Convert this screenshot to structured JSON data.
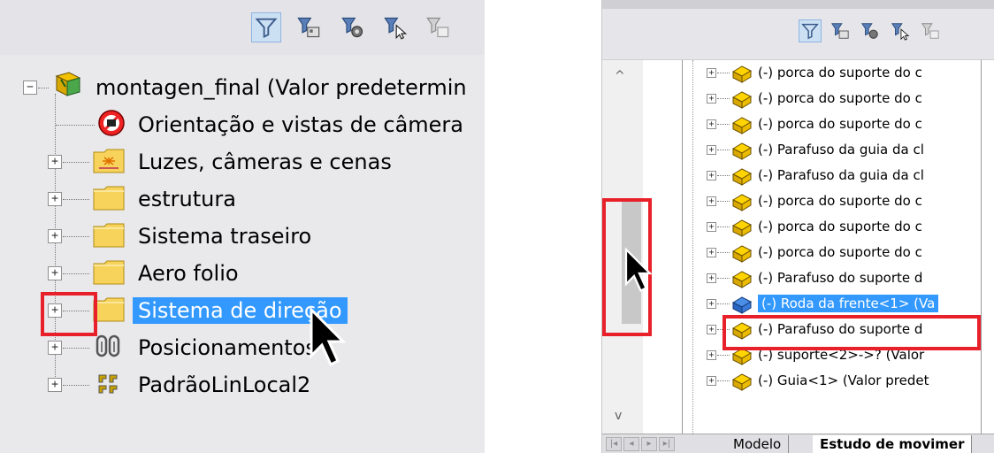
{
  "left_panel": {
    "tree": [
      {
        "label": "montagen_final  (Valor predetermin",
        "icon": "assembly-icon",
        "expander": "−"
      },
      {
        "label": "Orientação e vistas de câmera",
        "icon": "camera-orientation-icon",
        "expander": ""
      },
      {
        "label": "Luzes, câmeras e cenas",
        "icon": "lights-folder-icon",
        "expander": "+"
      },
      {
        "label": "estrutura",
        "icon": "folder-icon",
        "expander": "+"
      },
      {
        "label": "Sistema traseiro",
        "icon": "folder-icon",
        "expander": "+"
      },
      {
        "label": "Aero folio",
        "icon": "folder-icon",
        "expander": "+"
      },
      {
        "label": "Sistema de direção",
        "icon": "folder-icon",
        "expander": "+",
        "selected": true
      },
      {
        "label": "Posicionamentos",
        "icon": "mates-icon",
        "expander": "+"
      },
      {
        "label": "PadrãoLinLocal2",
        "icon": "linear-pattern-icon",
        "expander": "+"
      }
    ]
  },
  "right_panel": {
    "tree": [
      {
        "label": "(-) porca do suporte do c",
        "icon": "part-icon"
      },
      {
        "label": "(-) porca do suporte do c",
        "icon": "part-icon"
      },
      {
        "label": "(-) porca do suporte do c",
        "icon": "part-icon"
      },
      {
        "label": "(-) Parafuso da guia da cl",
        "icon": "part-icon"
      },
      {
        "label": "(-) Parafuso da guia da cl",
        "icon": "part-icon"
      },
      {
        "label": "(-) porca do suporte do c",
        "icon": "part-icon"
      },
      {
        "label": "(-) porca do suporte do c",
        "icon": "part-icon"
      },
      {
        "label": "(-) porca do suporte do c",
        "icon": "part-icon"
      },
      {
        "label": "(-) Parafuso do suporte d",
        "icon": "part-icon"
      },
      {
        "label": "(-) Roda da frente<1> (Va",
        "icon": "part-icon",
        "selected": true
      },
      {
        "label": "(-) Parafuso do suporte d",
        "icon": "part-icon"
      },
      {
        "label": "(-) suporte<2>->? (Valor",
        "icon": "part-icon"
      },
      {
        "label": "(-) Guia<1> (Valor predet",
        "icon": "part-icon"
      }
    ],
    "tabs": {
      "model": "Modelo",
      "motion_study": "Estudo de movimer"
    },
    "scroll_up": "^",
    "scroll_down": "v"
  },
  "toolbar_icons": [
    "filter-icon",
    "filter-hide-components-icon",
    "filter-features-icon",
    "filter-selection-icon",
    "filter-options-icon"
  ],
  "colors": {
    "highlight_red": "#e8202a",
    "selection_blue": "#3399ff",
    "part_yellow": "#f2c200",
    "folder_yellow": "#f7d35c"
  }
}
